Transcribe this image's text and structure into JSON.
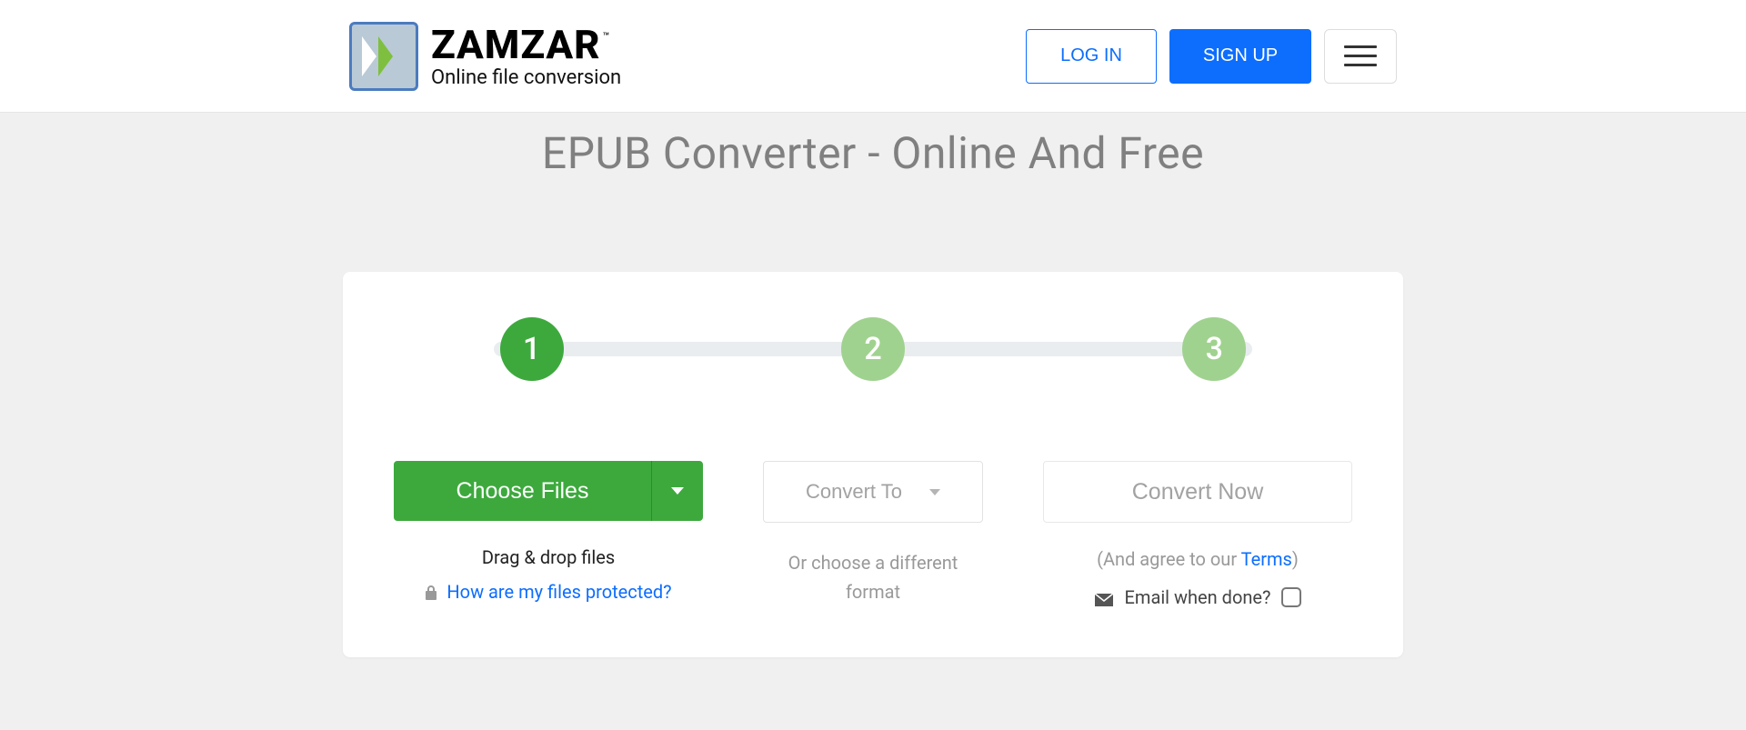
{
  "header": {
    "brand": "ZAMZAR",
    "trademark": "™",
    "tagline": "Online file conversion",
    "login_label": "LOG IN",
    "signup_label": "SIGN UP"
  },
  "page": {
    "title": "EPUB Converter - Online And Free"
  },
  "steps": {
    "one": "1",
    "two": "2",
    "three": "3"
  },
  "choose": {
    "button_label": "Choose Files",
    "drag_drop": "Drag & drop files",
    "protected_link": "How are my files protected?"
  },
  "convert_to": {
    "label": "Convert To",
    "alt_line": "Or choose a different format"
  },
  "convert_now": {
    "label": "Convert Now",
    "agree_prefix": "(And agree to our ",
    "agree_link": "Terms",
    "agree_suffix": ")",
    "email_label": "Email when done?"
  }
}
